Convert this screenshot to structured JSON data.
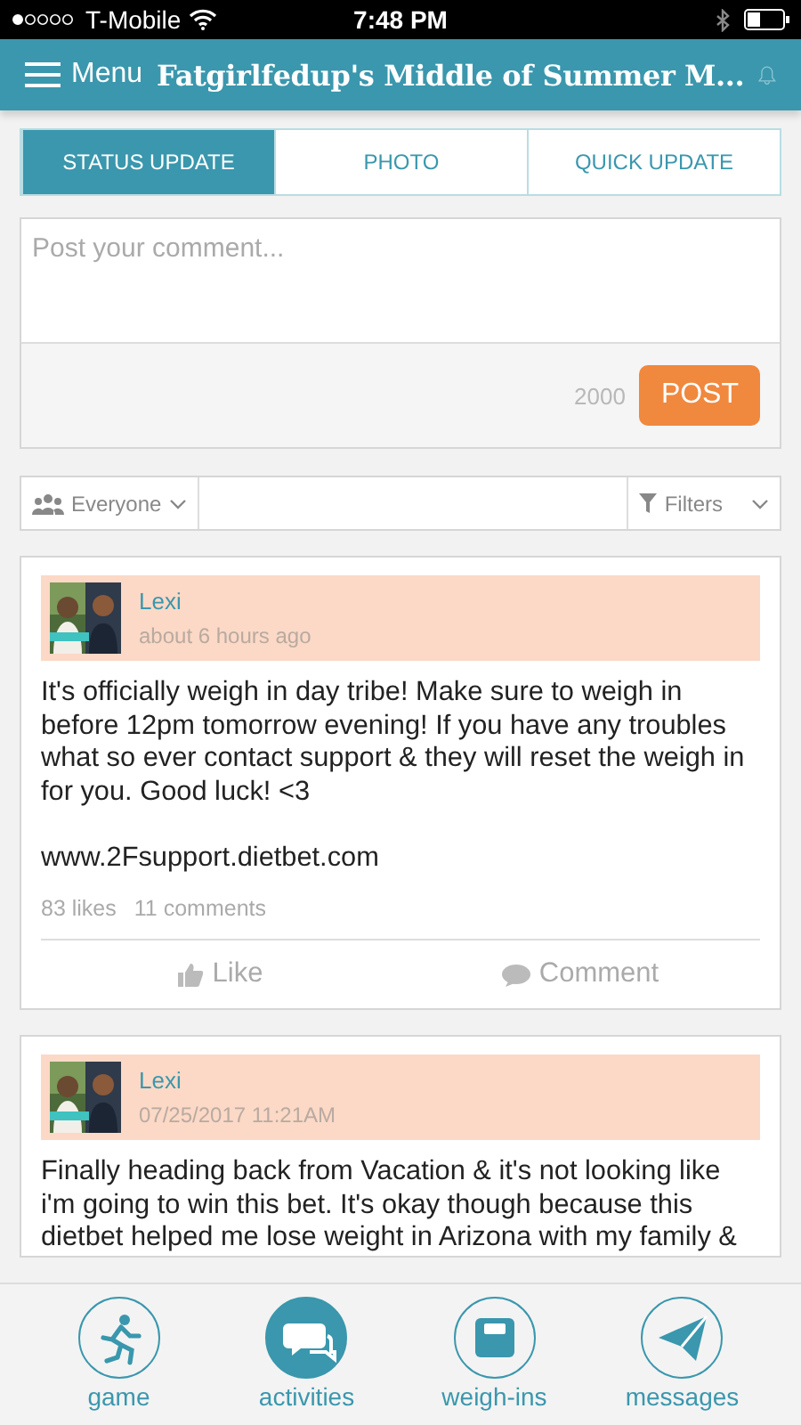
{
  "status_bar": {
    "carrier": "T-Mobile",
    "time": "7:48 PM"
  },
  "header": {
    "menu_label": "Menu",
    "title": "Fatgirlfedup's Middle of Summer M..."
  },
  "tabs": [
    {
      "label": "STATUS UPDATE",
      "selected": true
    },
    {
      "label": "PHOTO",
      "selected": false
    },
    {
      "label": "QUICK UPDATE",
      "selected": false
    }
  ],
  "composer": {
    "placeholder": "Post your comment...",
    "char_count": "2000",
    "post_button": "POST"
  },
  "filter_bar": {
    "audience": "Everyone",
    "filters": "Filters"
  },
  "posts": [
    {
      "author": "Lexi",
      "time": "about 6 hours ago",
      "text": "It's officially weigh in day tribe! Make sure to weigh in before 12pm tomorrow evening! If you have any troubles what so ever contact support & they will reset the weigh in for you. Good luck! <3",
      "link": "www.2Fsupport.dietbet.com",
      "likes": "83 likes",
      "comments": "11 comments",
      "like_button": "Like",
      "comment_button": "Comment"
    },
    {
      "author": "Lexi",
      "time": "07/25/2017 11:21AM",
      "text": "Finally heading back from Vacation & it's not looking like i'm going to win this bet. It's okay though because this dietbet helped me lose weight in Arizona with my family &"
    }
  ],
  "bottom_nav": [
    {
      "label": "game",
      "kind": "game",
      "selected": false
    },
    {
      "label": "activities",
      "kind": "activities",
      "selected": true
    },
    {
      "label": "weigh-ins",
      "kind": "weighins",
      "selected": false
    },
    {
      "label": "messages",
      "kind": "messages",
      "selected": false
    }
  ]
}
